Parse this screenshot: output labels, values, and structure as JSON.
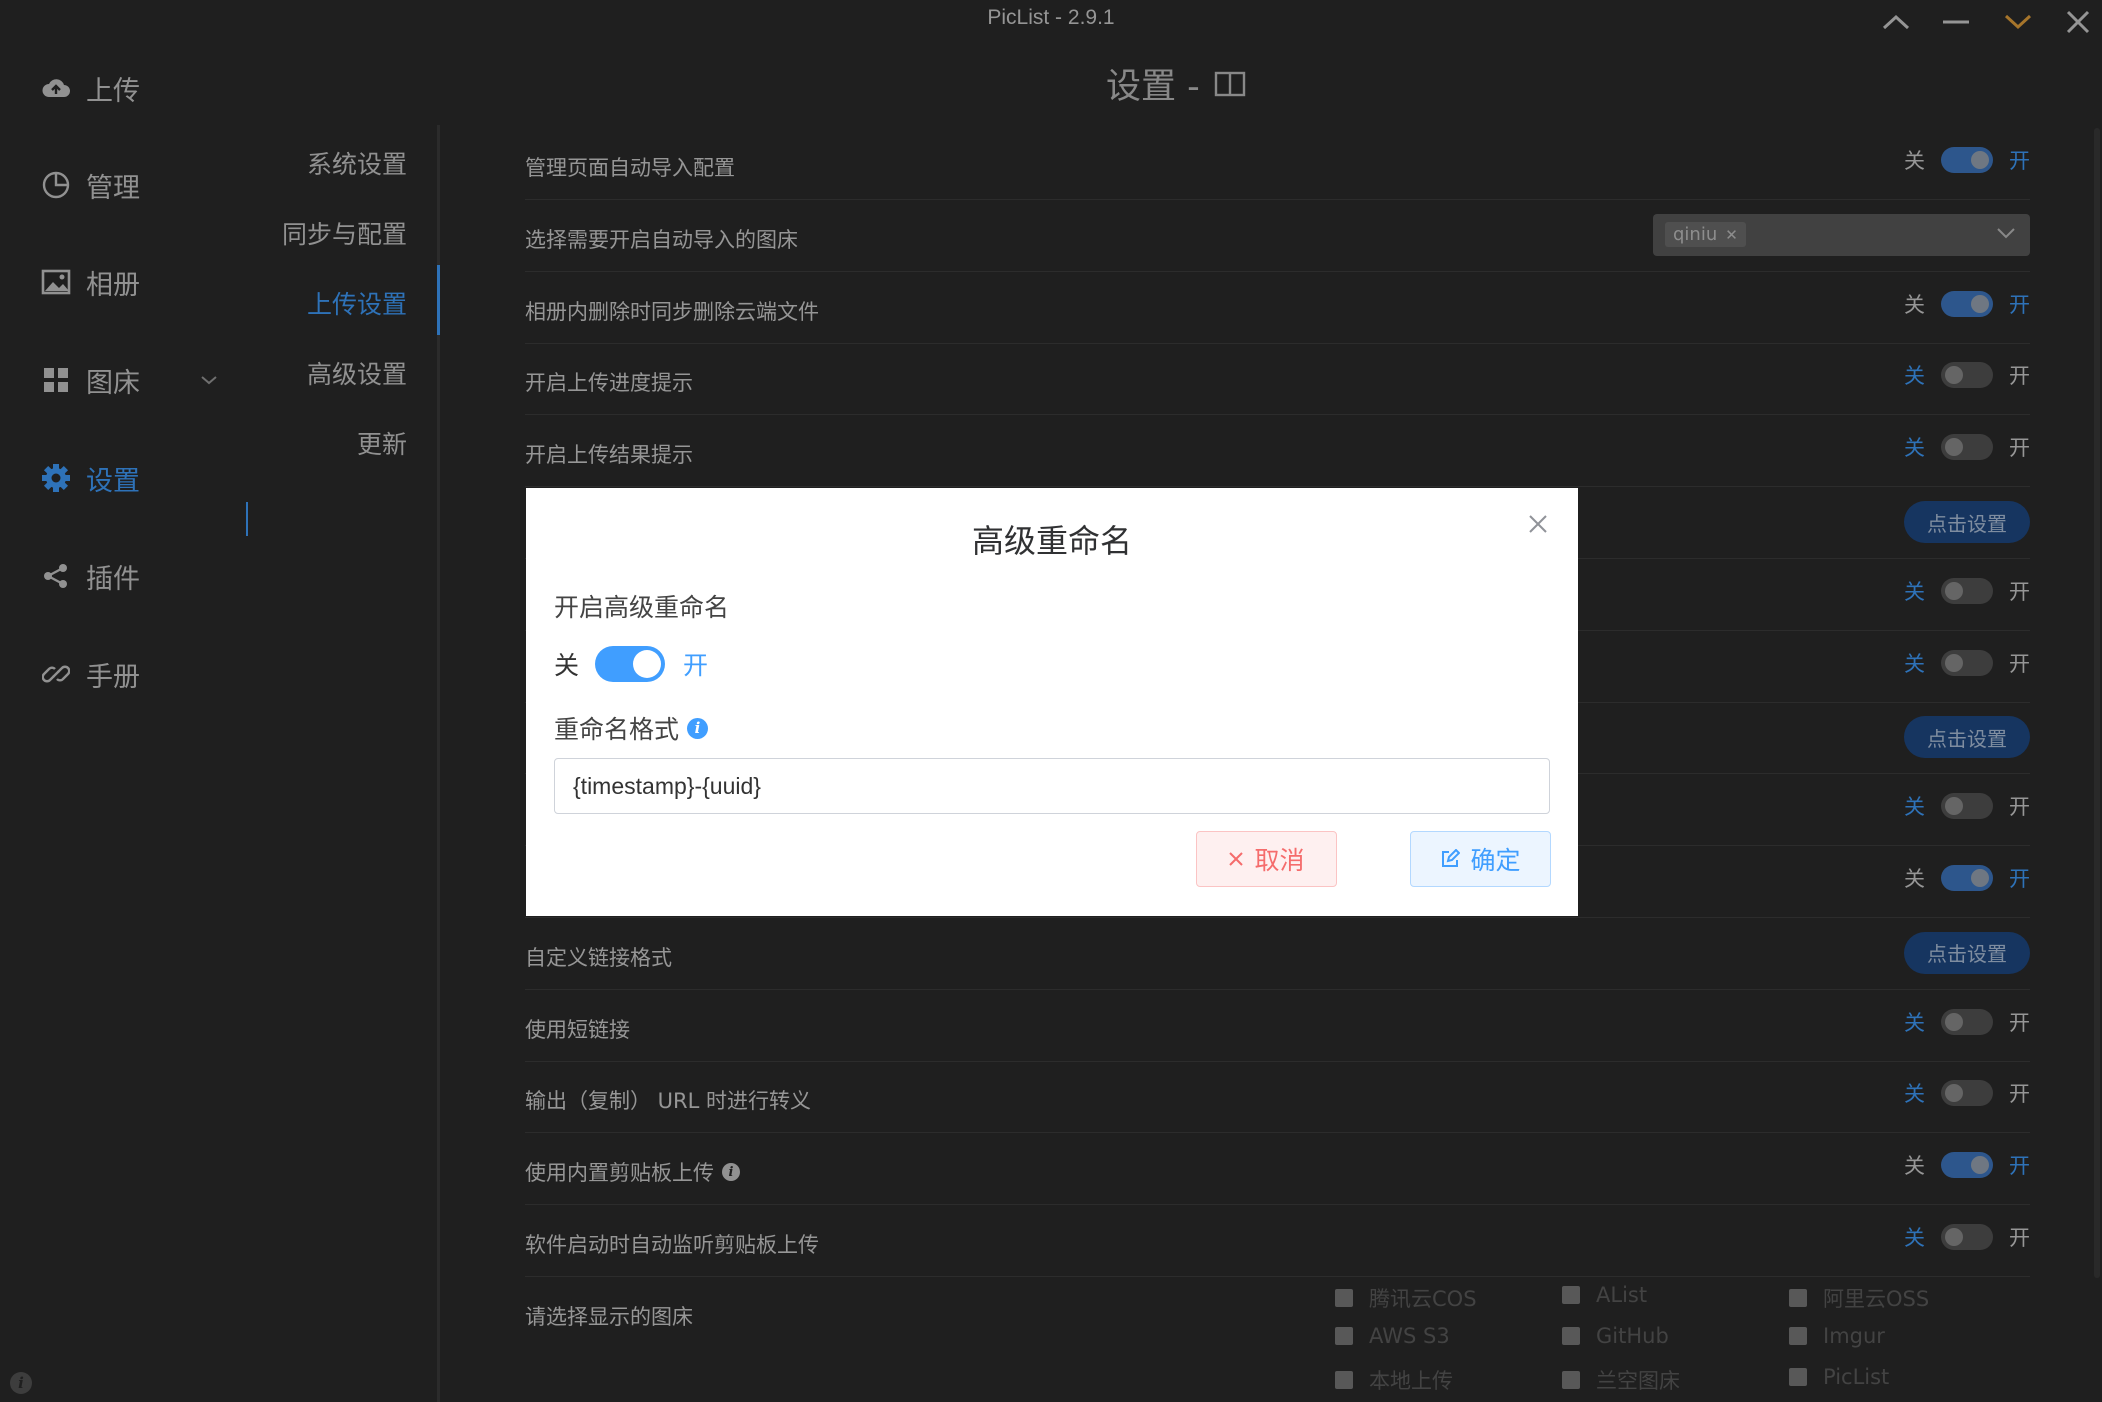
{
  "window": {
    "title": "PicList - 2.9.1"
  },
  "mainnav": {
    "items": [
      {
        "label": "上传",
        "icon": "cloud-upload-icon"
      },
      {
        "label": "管理",
        "icon": "pie-chart-icon"
      },
      {
        "label": "相册",
        "icon": "picture-icon"
      },
      {
        "label": "图床",
        "icon": "grid-icon"
      },
      {
        "label": "设置",
        "icon": "gear-icon",
        "active": true
      },
      {
        "label": "插件",
        "icon": "share-icon"
      },
      {
        "label": "手册",
        "icon": "link-icon"
      }
    ]
  },
  "subnav": {
    "items": [
      {
        "label": "系统设置"
      },
      {
        "label": "同步与配置"
      },
      {
        "label": "上传设置",
        "active": true
      },
      {
        "label": "高级设置"
      },
      {
        "label": "更新"
      }
    ]
  },
  "page": {
    "title": "设置 -"
  },
  "switch_labels": {
    "off": "关",
    "on": "开"
  },
  "settings": {
    "rows": [
      {
        "label": "管理页面自动导入配置",
        "type": "switch",
        "value": true
      },
      {
        "label": "选择需要开启自动导入的图床",
        "type": "select",
        "tags": [
          "qiniu"
        ]
      },
      {
        "label": "相册内删除时同步删除云端文件",
        "type": "switch",
        "value": true
      },
      {
        "label": "开启上传进度提示",
        "type": "switch",
        "value": false
      },
      {
        "label": "开启上传结果提示",
        "type": "switch",
        "value": false
      },
      {
        "label": "",
        "type": "button",
        "button": "点击设置"
      },
      {
        "label": "",
        "type": "switch",
        "value": false
      },
      {
        "label": "",
        "type": "switch",
        "value": false
      },
      {
        "label": "",
        "type": "button",
        "button": "点击设置"
      },
      {
        "label": "",
        "type": "switch",
        "value": false
      },
      {
        "label": "",
        "type": "switch",
        "value": true
      },
      {
        "label": "自定义链接格式",
        "type": "button",
        "button": "点击设置"
      },
      {
        "label": "使用短链接",
        "type": "switch",
        "value": false
      },
      {
        "label": "输出（复制） URL 时进行转义",
        "type": "switch",
        "value": false
      },
      {
        "label": "使用内置剪贴板上传",
        "type": "switch",
        "value": true,
        "info": true
      },
      {
        "label": "软件启动时自动监听剪贴板上传",
        "type": "switch",
        "value": false
      },
      {
        "label": "请选择显示的图床",
        "type": "checks"
      }
    ],
    "picbeds": [
      "腾讯云COS",
      "AList",
      "阿里云OSS",
      "AWS S3",
      "GitHub",
      "Imgur",
      "本地上传",
      "兰空图床",
      "PicList"
    ]
  },
  "dialog": {
    "title": "高级重命名",
    "enable_label": "开启高级重命名",
    "switch_off": "关",
    "switch_on": "开",
    "enabled": true,
    "format_label": "重命名格式",
    "format_value": "{timestamp}-{uuid}",
    "cancel": "取消",
    "confirm": "确定"
  },
  "colors": {
    "accent": "#409eff",
    "bg": "#2b2b2b",
    "danger": "#f56c6c"
  }
}
